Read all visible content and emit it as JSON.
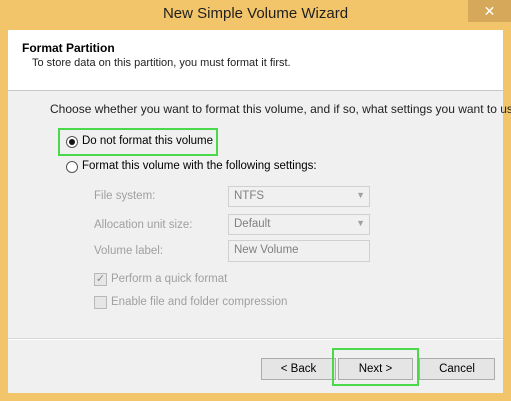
{
  "window": {
    "title": "New Simple Volume Wizard",
    "close_glyph": "✕"
  },
  "header": {
    "title": "Format Partition",
    "subtitle": "To store data on this partition, you must format it first."
  },
  "prompt": "Choose whether you want to format this volume, and if so, what settings you want to use.",
  "options": {
    "no_format": {
      "label": "Do not format this volume",
      "selected": true
    },
    "format": {
      "label": "Format this volume with the following settings:",
      "selected": false
    }
  },
  "settings": {
    "file_system": {
      "label": "File system:",
      "value": "NTFS"
    },
    "allocation_unit": {
      "label": "Allocation unit size:",
      "value": "Default"
    },
    "volume_label": {
      "label": "Volume label:",
      "value": "New Volume"
    },
    "quick_format": {
      "label": "Perform a quick format",
      "checked": true
    },
    "compression": {
      "label": "Enable file and folder compression",
      "checked": false
    }
  },
  "buttons": {
    "back": "< Back",
    "next": "Next >",
    "cancel": "Cancel"
  },
  "colors": {
    "title_bar": "#f3c56a",
    "highlight": "#4ad94a",
    "disabled_text": "#a0a0a0"
  }
}
